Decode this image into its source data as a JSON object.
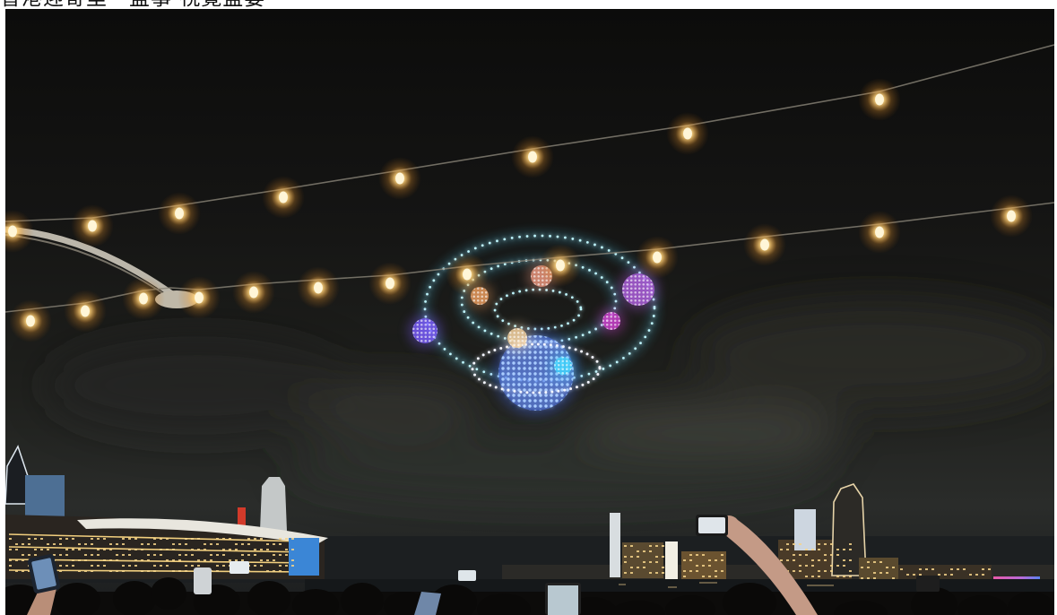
{
  "caption": "香港迎寄里一盛事 視覺盛宴",
  "colors": {
    "drone_cyan": "#bff6ff",
    "drone_glow": "#53d6ff",
    "saturn_ring": "#f4f6ff",
    "planet_blue": "#3f64e0",
    "bulb_core": "#fff6d8",
    "night_sky": "#141413"
  }
}
